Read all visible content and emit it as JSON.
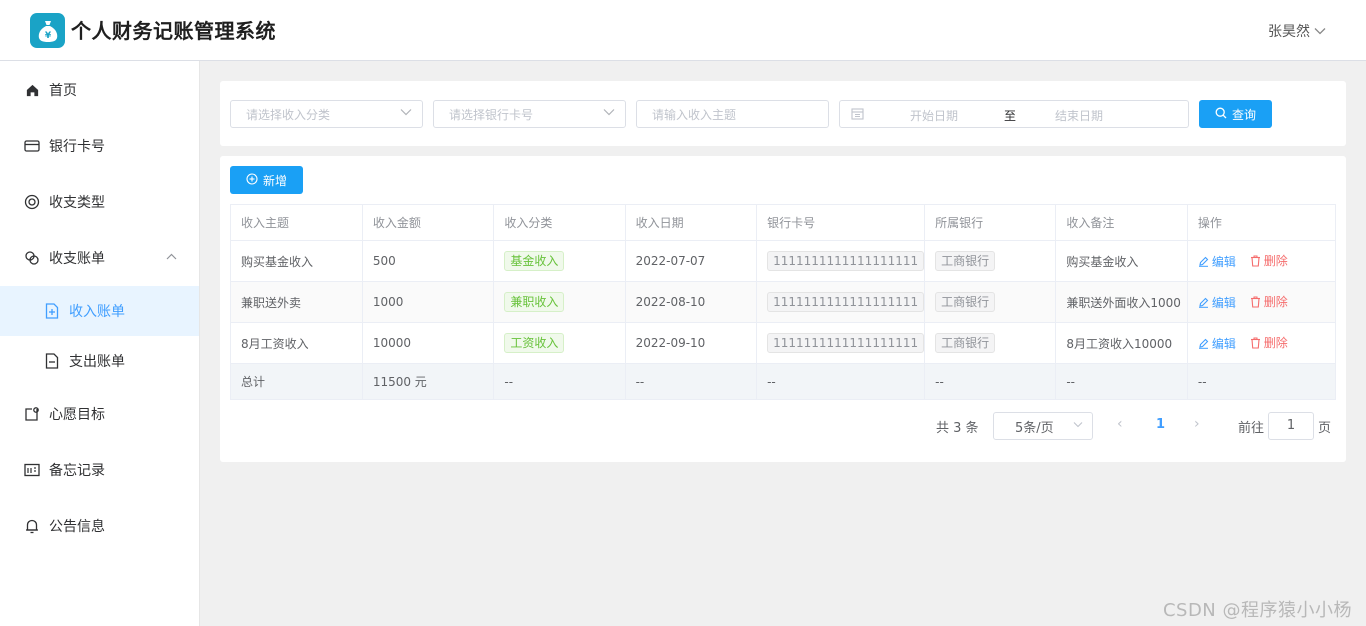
{
  "app": {
    "title": "个人财务记账管理系统",
    "user": "张昊然"
  },
  "sidebar": {
    "items": [
      {
        "label": "首页"
      },
      {
        "label": "银行卡号"
      },
      {
        "label": "收支类型"
      },
      {
        "label": "收支账单"
      },
      {
        "label": "收入账单"
      },
      {
        "label": "支出账单"
      },
      {
        "label": "心愿目标"
      },
      {
        "label": "备忘记录"
      },
      {
        "label": "公告信息"
      }
    ]
  },
  "filters": {
    "category_placeholder": "请选择收入分类",
    "bank_placeholder": "请选择银行卡号",
    "subject_placeholder": "请输入收入主题",
    "start_date_placeholder": "开始日期",
    "date_separator": "至",
    "end_date_placeholder": "结束日期",
    "search_label": "查询"
  },
  "toolbar": {
    "add_label": "新增"
  },
  "table": {
    "headers": [
      "收入主题",
      "收入金额",
      "收入分类",
      "收入日期",
      "银行卡号",
      "所属银行",
      "收入备注",
      "操作"
    ],
    "rows": [
      {
        "subject": "购买基金收入",
        "amount": "500",
        "category": "基金收入",
        "date": "2022-07-07",
        "card": "1111111111111111111",
        "bank": "工商银行",
        "note": "购买基金收入"
      },
      {
        "subject": "兼职送外卖",
        "amount": "1000",
        "category": "兼职收入",
        "date": "2022-08-10",
        "card": "1111111111111111111",
        "bank": "工商银行",
        "note": "兼职送外面收入1000"
      },
      {
        "subject": "8月工资收入",
        "amount": "10000",
        "category": "工资收入",
        "date": "2022-09-10",
        "card": "1111111111111111111",
        "bank": "工商银行",
        "note": "8月工资收入10000"
      }
    ],
    "edit_label": "编辑",
    "delete_label": "删除",
    "total": {
      "label": "总计",
      "amount": "11500 元",
      "empty": "--"
    }
  },
  "pagination": {
    "total_text": "共 3 条",
    "page_size": "5条/页",
    "prev": "‹",
    "current_page": "1",
    "next": "›",
    "goto_label": "前往",
    "goto_value": "1",
    "page_suffix": "页"
  },
  "watermark": "CSDN @程序猿小小杨",
  "colors": {
    "primary": "#1aa0f5",
    "logo": "#1aa3c6",
    "active_bg": "#e8f4ff",
    "danger": "#f56c6c",
    "success": "#67c23a"
  }
}
